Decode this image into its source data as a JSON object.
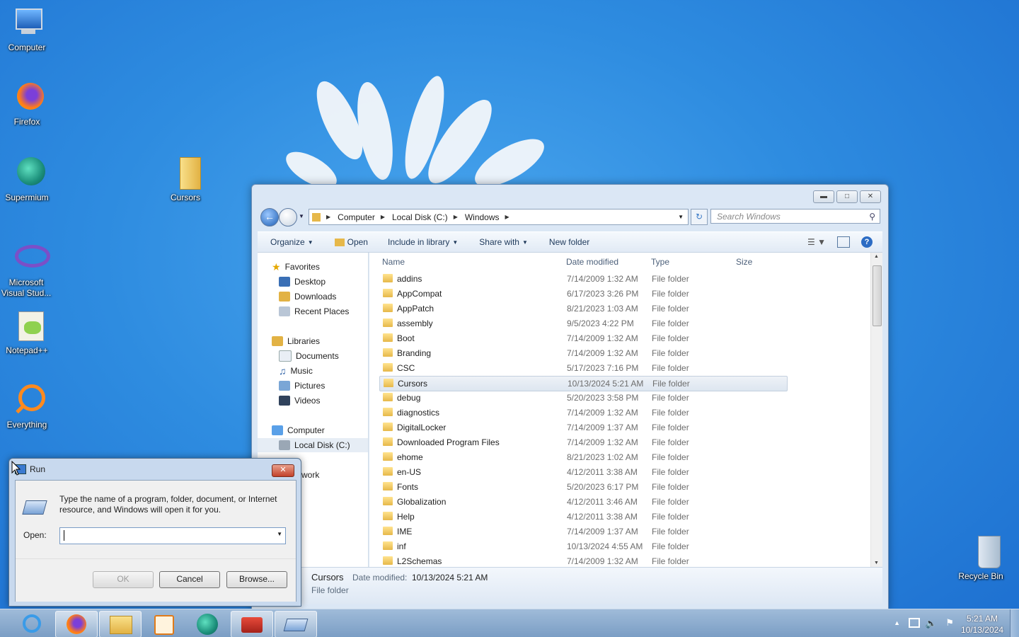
{
  "desktop": {
    "icons": [
      {
        "label": "Computer",
        "icon": "computer-icon"
      },
      {
        "label": "Firefox",
        "icon": "firefox-icon"
      },
      {
        "label": "Supermium",
        "icon": "supermium-icon"
      },
      {
        "label": "Microsoft Visual Stud...",
        "icon": "visual-studio-icon"
      },
      {
        "label": "Notepad++",
        "icon": "notepadpp-icon"
      },
      {
        "label": "Everything",
        "icon": "everything-icon"
      },
      {
        "label": "Cursors",
        "icon": "folder-icon"
      },
      {
        "label": "Recycle Bin",
        "icon": "recycle-bin-icon"
      }
    ]
  },
  "explorer": {
    "breadcrumb": [
      "Computer",
      "Local Disk (C:)",
      "Windows"
    ],
    "search_placeholder": "Search Windows",
    "toolbar": {
      "organize": "Organize",
      "open": "Open",
      "include": "Include in library",
      "share": "Share with",
      "new_folder": "New folder"
    },
    "nav": {
      "favorites": "Favorites",
      "desktop": "Desktop",
      "downloads": "Downloads",
      "recent": "Recent Places",
      "libraries": "Libraries",
      "documents": "Documents",
      "music": "Music",
      "pictures": "Pictures",
      "videos": "Videos",
      "computer": "Computer",
      "local_disk": "Local Disk (C:)",
      "network_partial": "work"
    },
    "columns": {
      "name": "Name",
      "date": "Date modified",
      "type": "Type",
      "size": "Size"
    },
    "rows": [
      {
        "name": "addins",
        "date": "7/14/2009 1:32 AM",
        "type": "File folder"
      },
      {
        "name": "AppCompat",
        "date": "6/17/2023 3:26 PM",
        "type": "File folder"
      },
      {
        "name": "AppPatch",
        "date": "8/21/2023 1:03 AM",
        "type": "File folder"
      },
      {
        "name": "assembly",
        "date": "9/5/2023 4:22 PM",
        "type": "File folder"
      },
      {
        "name": "Boot",
        "date": "7/14/2009 1:32 AM",
        "type": "File folder"
      },
      {
        "name": "Branding",
        "date": "7/14/2009 1:32 AM",
        "type": "File folder"
      },
      {
        "name": "CSC",
        "date": "5/17/2023 7:16 PM",
        "type": "File folder"
      },
      {
        "name": "Cursors",
        "date": "10/13/2024 5:21 AM",
        "type": "File folder",
        "selected": true
      },
      {
        "name": "debug",
        "date": "5/20/2023 3:58 PM",
        "type": "File folder"
      },
      {
        "name": "diagnostics",
        "date": "7/14/2009 1:32 AM",
        "type": "File folder"
      },
      {
        "name": "DigitalLocker",
        "date": "7/14/2009 1:37 AM",
        "type": "File folder"
      },
      {
        "name": "Downloaded Program Files",
        "date": "7/14/2009 1:32 AM",
        "type": "File folder"
      },
      {
        "name": "ehome",
        "date": "8/21/2023 1:02 AM",
        "type": "File folder"
      },
      {
        "name": "en-US",
        "date": "4/12/2011 3:38 AM",
        "type": "File folder"
      },
      {
        "name": "Fonts",
        "date": "5/20/2023 6:17 PM",
        "type": "File folder"
      },
      {
        "name": "Globalization",
        "date": "4/12/2011 3:46 AM",
        "type": "File folder"
      },
      {
        "name": "Help",
        "date": "4/12/2011 3:38 AM",
        "type": "File folder"
      },
      {
        "name": "IME",
        "date": "7/14/2009 1:37 AM",
        "type": "File folder"
      },
      {
        "name": "inf",
        "date": "10/13/2024 4:55 AM",
        "type": "File folder"
      },
      {
        "name": "L2Schemas",
        "date": "7/14/2009 1:32 AM",
        "type": "File folder"
      }
    ],
    "details": {
      "name": "Cursors",
      "date_label": "Date modified:",
      "date": "10/13/2024 5:21 AM",
      "type": "File folder"
    }
  },
  "run": {
    "title": "Run",
    "description": "Type the name of a program, folder, document, or Internet resource, and Windows will open it for you.",
    "open_label": "Open:",
    "open_value": "",
    "ok": "OK",
    "cancel": "Cancel",
    "browse": "Browse..."
  },
  "taskbar": {
    "time": "5:21 AM",
    "date": "10/13/2024"
  }
}
